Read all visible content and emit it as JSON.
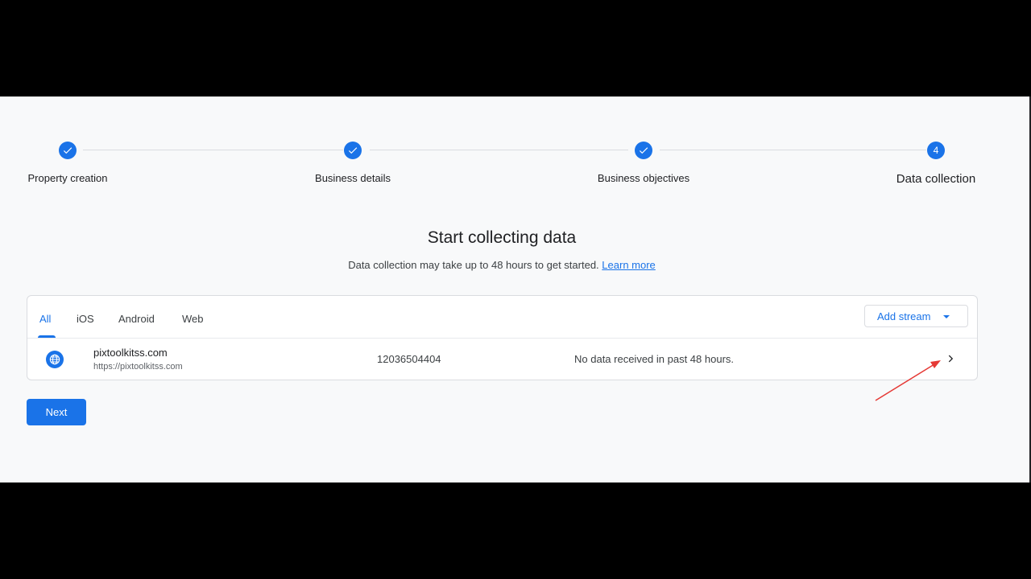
{
  "stepper": {
    "steps": [
      {
        "label": "Property creation",
        "state": "done"
      },
      {
        "label": "Business details",
        "state": "done"
      },
      {
        "label": "Business objectives",
        "state": "done"
      },
      {
        "label": "Data collection",
        "state": "active",
        "number": "4"
      }
    ]
  },
  "header": {
    "title": "Start collecting data",
    "subtitle": "Data collection may take up to 48 hours to get started.",
    "learn_more": "Learn more"
  },
  "tabs": [
    {
      "label": "All",
      "active": true
    },
    {
      "label": "iOS",
      "active": false
    },
    {
      "label": "Android",
      "active": false
    },
    {
      "label": "Web",
      "active": false
    }
  ],
  "add_stream_label": "Add stream",
  "stream": {
    "name": "pixtoolkitss.com",
    "url": "https://pixtoolkitss.com",
    "id": "12036504404",
    "status": "No data received in past 48 hours."
  },
  "next_label": "Next",
  "colors": {
    "primary": "#1a73e8",
    "background": "#f8f9fa",
    "annotation": "#e53935"
  }
}
